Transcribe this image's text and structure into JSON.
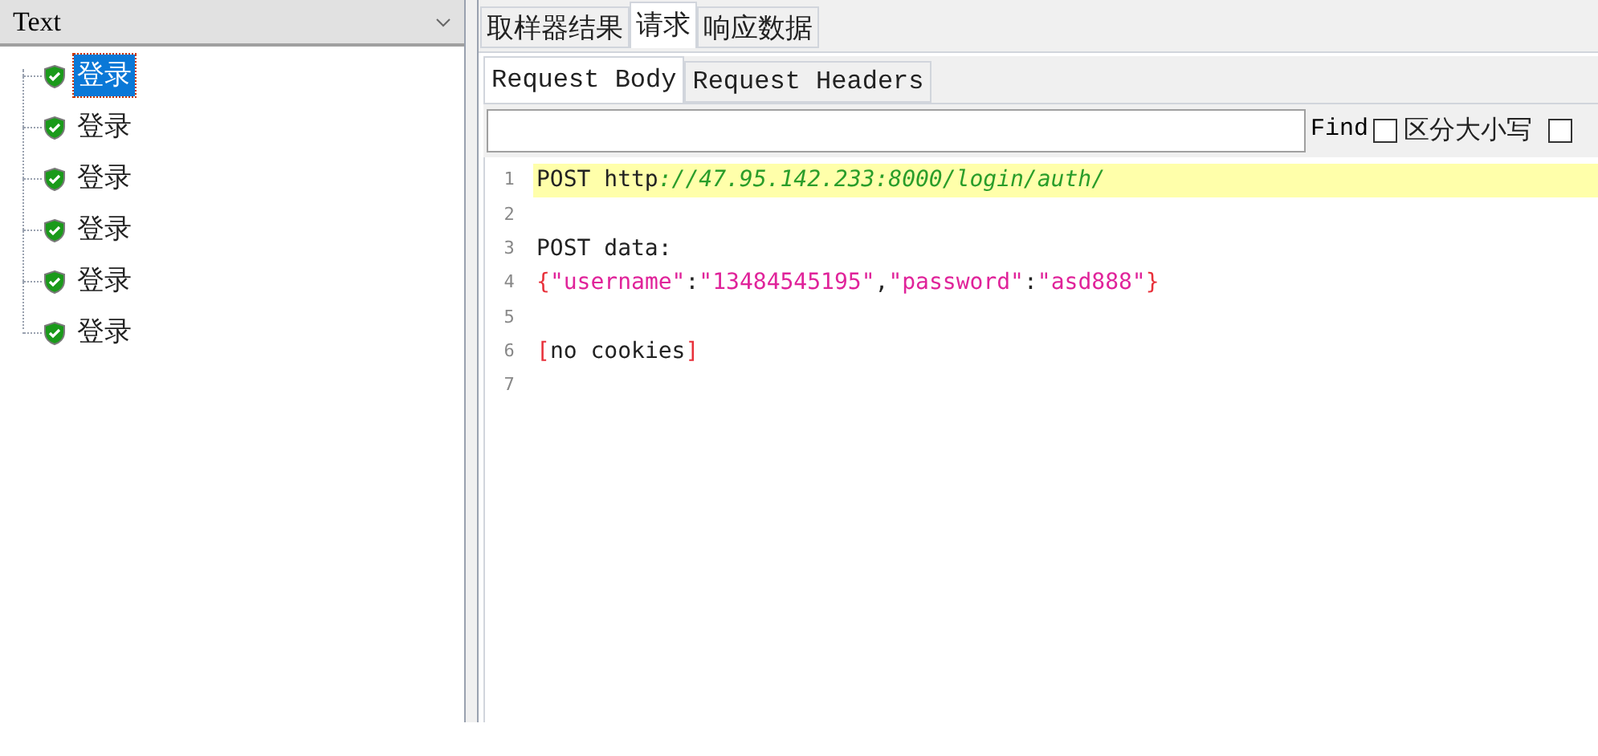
{
  "left_panel": {
    "view_selector": "Text",
    "tree": {
      "items": [
        {
          "label": "登录",
          "selected": true
        },
        {
          "label": "登录",
          "selected": false
        },
        {
          "label": "登录",
          "selected": false
        },
        {
          "label": "登录",
          "selected": false
        },
        {
          "label": "登录",
          "selected": false
        },
        {
          "label": "登录",
          "selected": false
        }
      ]
    }
  },
  "tabs": [
    {
      "label": "取样器结果",
      "selected": false
    },
    {
      "label": "请求",
      "selected": true
    },
    {
      "label": "响应数据",
      "selected": false
    }
  ],
  "sub_tabs": [
    {
      "label": "Request Body",
      "selected": true
    },
    {
      "label": "Request Headers",
      "selected": false
    }
  ],
  "search": {
    "find_label": "Find",
    "checkboxes": [
      {
        "label": "区分大小写",
        "checked": false
      },
      {
        "checked": false
      }
    ]
  },
  "editor": {
    "lines": [
      {
        "number": "1",
        "highlighted": true,
        "tokens": [
          {
            "kind": "plain",
            "text": "POST http"
          },
          {
            "kind": "url",
            "text": "://47.95.142.233:8000/login/auth/"
          }
        ]
      },
      {
        "number": "2",
        "highlighted": false
      },
      {
        "number": "3",
        "highlighted": false,
        "tokens": [
          {
            "kind": "plain",
            "text": "POST data:"
          }
        ]
      },
      {
        "number": "4",
        "highlighted": false,
        "tokens": [
          {
            "kind": "bracket",
            "text": "{"
          },
          {
            "kind": "string",
            "text": "\"username\""
          },
          {
            "kind": "plain",
            "text": ":"
          },
          {
            "kind": "string",
            "text": "\"13484545195\""
          },
          {
            "kind": "plain",
            "text": ","
          },
          {
            "kind": "string",
            "text": "\"password\""
          },
          {
            "kind": "plain",
            "text": ":"
          },
          {
            "kind": "string",
            "text": "\"asd888\""
          },
          {
            "kind": "bracket",
            "text": "}"
          }
        ]
      },
      {
        "number": "5",
        "highlighted": false
      },
      {
        "number": "6",
        "highlighted": false,
        "tokens": [
          {
            "kind": "bracket",
            "text": "["
          },
          {
            "kind": "plain",
            "text": "no cookies"
          },
          {
            "kind": "bracket",
            "text": "]"
          }
        ]
      },
      {
        "number": "7",
        "highlighted": false
      }
    ]
  }
}
